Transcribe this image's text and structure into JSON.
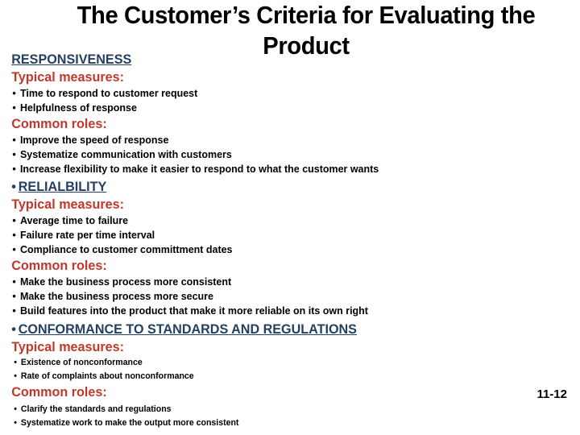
{
  "slide": {
    "title": "The Customer’s Criteria for Evaluating the Product",
    "page_number": "11-12",
    "colors": {
      "section_heading": "#244061",
      "sub_heading": "#C0392B",
      "body_text": "#000000",
      "background": "#FFFFFF"
    },
    "labels": {
      "typical_measures": "Typical measures:",
      "common_roles": "Common roles:",
      "bullet_glyph": "•"
    },
    "sections": [
      {
        "heading": "RESPONSIVENESS",
        "heading_has_bullet": false,
        "typical_measures_label": "Typical measures:",
        "typical_measures": [
          "Time to respond to customer request",
          "Helpfulness of response"
        ],
        "common_roles_label": "Common roles:",
        "common_roles": [
          "Improve the speed of response",
          "Systematize communication with customers",
          "Increase flexibility to make it easier to respond to what the customer wants"
        ]
      },
      {
        "heading": "RELIALBILITY",
        "heading_has_bullet": true,
        "typical_measures_label": "Typical measures:",
        "typical_measures": [
          "Average time to failure",
          "Failure rate per time interval",
          "Compliance to customer committment dates"
        ],
        "common_roles_label": "Common roles:",
        "common_roles": [
          "Make the business process more consistent",
          "Make the business process more secure",
          "Build features into the product that make it more reliable on its own right"
        ]
      },
      {
        "heading": "CONFORMANCE TO STANDARDS AND REGULATIONS",
        "heading_has_bullet": true,
        "typical_measures_label": "Typical measures:",
        "typical_measures": [
          "Existence of nonconformance",
          "Rate of complaints about nonconformance"
        ],
        "common_roles_label": "Common roles:",
        "common_roles": [
          "Clarify the standards and regulations",
          "Systematize work to make the output more consistent"
        ]
      }
    ]
  }
}
